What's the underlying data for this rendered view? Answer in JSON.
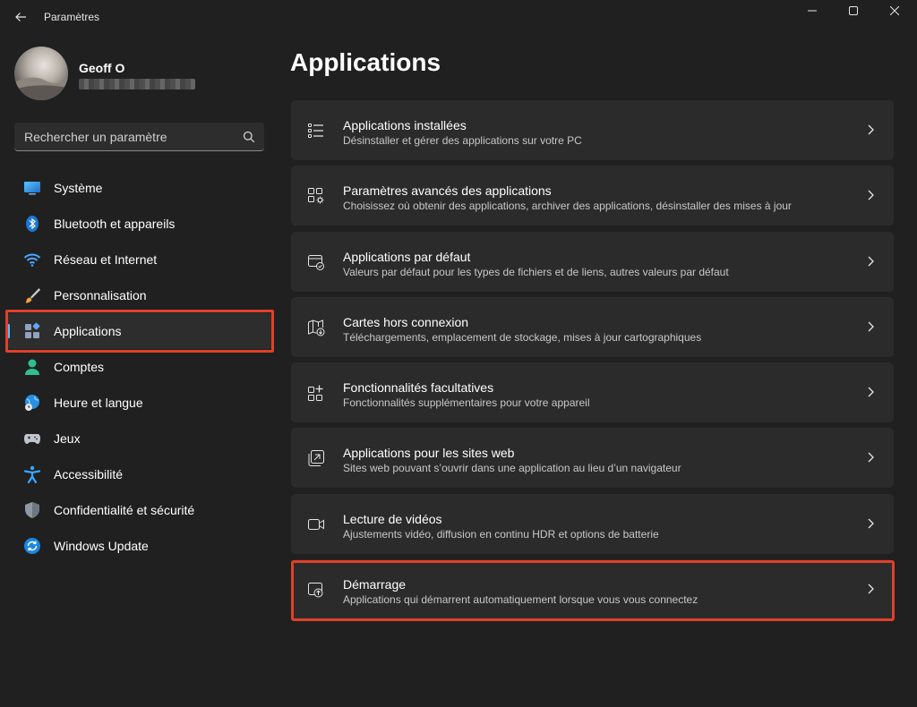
{
  "window": {
    "title": "Paramètres"
  },
  "profile": {
    "name": "Geoff O"
  },
  "search": {
    "placeholder": "Rechercher un paramètre"
  },
  "sidebar": {
    "items": [
      {
        "label": "Système",
        "icon": "monitor-icon"
      },
      {
        "label": "Bluetooth et appareils",
        "icon": "bluetooth-icon"
      },
      {
        "label": "Réseau et Internet",
        "icon": "wifi-icon"
      },
      {
        "label": "Personnalisation",
        "icon": "brush-icon"
      },
      {
        "label": "Applications",
        "icon": "apps-icon",
        "active": true
      },
      {
        "label": "Comptes",
        "icon": "person-icon"
      },
      {
        "label": "Heure et langue",
        "icon": "globe-clock-icon"
      },
      {
        "label": "Jeux",
        "icon": "gamepad-icon"
      },
      {
        "label": "Accessibilité",
        "icon": "accessibility-icon"
      },
      {
        "label": "Confidentialité et sécurité",
        "icon": "shield-icon"
      },
      {
        "label": "Windows Update",
        "icon": "update-icon"
      }
    ]
  },
  "main": {
    "title": "Applications",
    "cards": [
      {
        "title": "Applications installées",
        "desc": "Désinstaller et gérer des applications sur votre PC",
        "icon": "list-icon"
      },
      {
        "title": "Paramètres avancés des applications",
        "desc": "Choisissez où obtenir des applications, archiver des applications, désinstaller des mises à jour",
        "icon": "app-settings-icon"
      },
      {
        "title": "Applications par défaut",
        "desc": "Valeurs par défaut pour les types de fichiers et de liens, autres valeurs par défaut",
        "icon": "default-apps-icon"
      },
      {
        "title": "Cartes hors connexion",
        "desc": "Téléchargements, emplacement de stockage, mises à jour cartographiques",
        "icon": "map-download-icon"
      },
      {
        "title": "Fonctionnalités facultatives",
        "desc": "Fonctionnalités supplémentaires pour votre appareil",
        "icon": "add-apps-icon"
      },
      {
        "title": "Applications pour les sites web",
        "desc": "Sites web pouvant s’ouvrir dans une application au lieu d’un navigateur",
        "icon": "web-app-icon"
      },
      {
        "title": "Lecture de vidéos",
        "desc": "Ajustements vidéo, diffusion en continu HDR et options de batterie",
        "icon": "video-icon"
      },
      {
        "title": "Démarrage",
        "desc": "Applications qui démarrent automatiquement lorsque vous vous connectez",
        "icon": "startup-icon"
      }
    ]
  },
  "colors": {
    "accent": "#4cc2ff",
    "highlight": "#e0402a",
    "background": "#202020",
    "card": "#2b2b2b"
  }
}
